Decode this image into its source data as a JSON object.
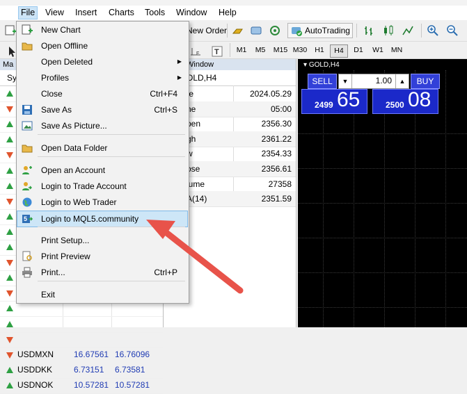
{
  "menubar": {
    "items": [
      "File",
      "View",
      "Insert",
      "Charts",
      "Tools",
      "Window",
      "Help"
    ]
  },
  "toolbar": {
    "new_order": "New Order",
    "autotrading": "AutoTrading"
  },
  "timeframes": [
    "M1",
    "M5",
    "M15",
    "M30",
    "H1",
    "H4",
    "D1",
    "W1",
    "MN"
  ],
  "market_watch": {
    "title": "Ma",
    "header": "Sy",
    "rows": [
      {
        "dir": "up"
      },
      {
        "dir": "down"
      },
      {
        "dir": "up"
      },
      {
        "dir": "up"
      },
      {
        "dir": "down"
      },
      {
        "dir": "up"
      },
      {
        "dir": "up"
      },
      {
        "dir": "down"
      },
      {
        "dir": "up"
      },
      {
        "dir": "up"
      },
      {
        "dir": "up"
      },
      {
        "dir": "down"
      },
      {
        "dir": "up"
      },
      {
        "dir": "down"
      },
      {
        "dir": "up"
      },
      {
        "dir": "up"
      },
      {
        "dir": "down"
      },
      {
        "dir": "down",
        "symbol": "USDMXN",
        "bid": "16.67561",
        "ask": "16.76096"
      },
      {
        "dir": "up",
        "symbol": "USDDKK",
        "bid": "6.73151",
        "ask": "6.73581"
      },
      {
        "dir": "up",
        "symbol": "USDNOK",
        "bid": "10.57281",
        "ask": "10.57281"
      }
    ]
  },
  "data_window": {
    "title": "Window",
    "symbol": "OLD,H4",
    "rows": [
      {
        "label": "te",
        "value": "2024.05.29"
      },
      {
        "label": "ne",
        "value": "05:00"
      },
      {
        "label": "pen",
        "value": "2356.30"
      },
      {
        "label": "gh",
        "value": "2361.22"
      },
      {
        "label": "w",
        "value": "2354.33"
      },
      {
        "label": "ose",
        "value": "2356.61"
      },
      {
        "label": "lume",
        "value": "27358"
      },
      {
        "label": "A(14)",
        "value": "2351.59"
      }
    ]
  },
  "chart": {
    "title": "GOLD,H4",
    "sell": "SELL",
    "buy": "BUY",
    "lot": "1.00",
    "bid_small": "2499",
    "bid_big": "65",
    "ask_small": "2500",
    "ask_big": "08"
  },
  "file_menu": {
    "items": [
      {
        "label": "New Chart",
        "shortcut": "",
        "icon": "new-chart-icon"
      },
      {
        "label": "Open Offline",
        "shortcut": "",
        "icon": "folder-open-icon"
      },
      {
        "label": "Open Deleted",
        "shortcut": "",
        "submenu": true
      },
      {
        "label": "Profiles",
        "shortcut": "",
        "submenu": true
      },
      {
        "label": "Close",
        "shortcut": "Ctrl+F4"
      },
      {
        "label": "Save As",
        "shortcut": "Ctrl+S",
        "icon": "save-icon"
      },
      {
        "label": "Save As Picture...",
        "shortcut": "",
        "icon": "picture-icon"
      },
      {
        "label": "Open Data Folder",
        "shortcut": "",
        "icon": "folder-icon"
      },
      {
        "label": "Open an Account",
        "shortcut": "",
        "icon": "user-add-icon"
      },
      {
        "label": "Login to Trade Account",
        "shortcut": "",
        "icon": "user-login-icon"
      },
      {
        "label": "Login to Web Trader",
        "shortcut": "",
        "icon": "globe-icon"
      },
      {
        "label": "Login to MQL5.community",
        "shortcut": "",
        "icon": "mql5-icon"
      },
      {
        "label": "Print Setup...",
        "shortcut": ""
      },
      {
        "label": "Print Preview",
        "shortcut": "",
        "icon": "print-preview-icon"
      },
      {
        "label": "Print...",
        "shortcut": "Ctrl+P",
        "icon": "printer-icon"
      },
      {
        "label": "Exit",
        "shortcut": ""
      }
    ]
  },
  "colors": {
    "highlight": "#cde6f7",
    "chart_bg": "#000000",
    "quote_bg": "#1b29c9",
    "annotation_arrow": "#e8534a"
  }
}
